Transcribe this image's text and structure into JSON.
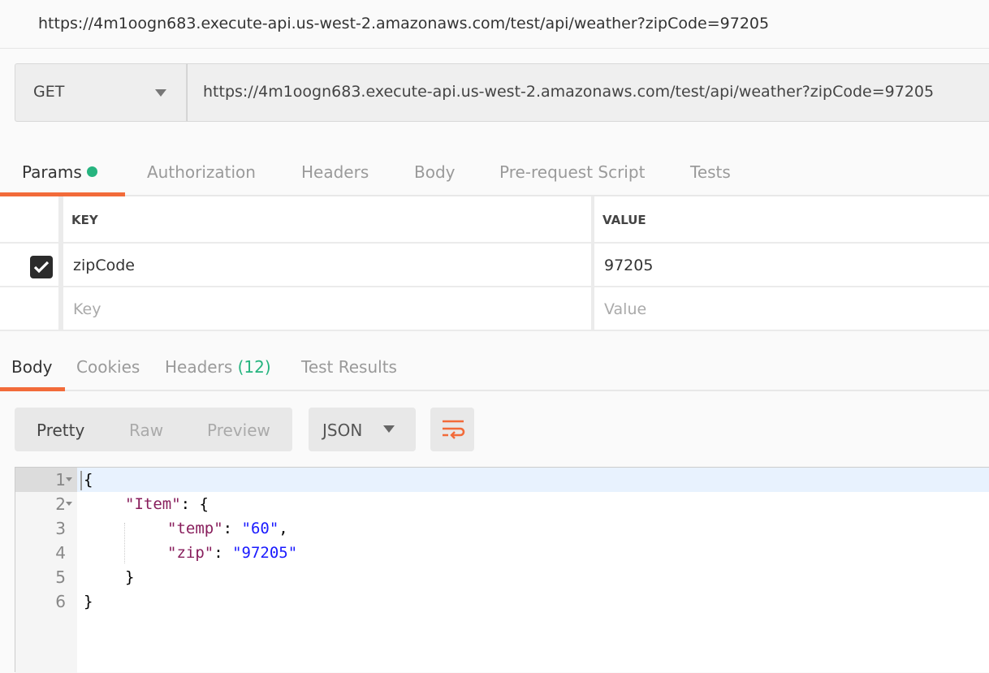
{
  "window": {
    "title": "https://4m1oogn683.execute-api.us-west-2.amazonaws.com/test/api/weather?zipCode=97205"
  },
  "request": {
    "method": "GET",
    "url": "https://4m1oogn683.execute-api.us-west-2.amazonaws.com/test/api/weather?zipCode=97205"
  },
  "request_tabs": [
    "Params",
    "Authorization",
    "Headers",
    "Body",
    "Pre-request Script",
    "Tests"
  ],
  "params": {
    "headers": {
      "key": "KEY",
      "value": "VALUE"
    },
    "rows": [
      {
        "checked": true,
        "key": "zipCode",
        "value": "97205"
      }
    ],
    "placeholder": {
      "key": "Key",
      "value": "Value"
    }
  },
  "response_tabs": {
    "body": "Body",
    "cookies": "Cookies",
    "headers": "Headers",
    "headers_count": "(12)",
    "tests": "Test Results"
  },
  "view_modes": [
    "Pretty",
    "Raw",
    "Preview"
  ],
  "format": "JSON",
  "wrap_icon": "wrap-lines-icon",
  "code_lines": [
    "1",
    "2",
    "3",
    "4",
    "5",
    "6"
  ],
  "code": {
    "l1": "{",
    "item_key": "\"Item\"",
    "item_rest": ": {",
    "temp_key": "\"temp\"",
    "temp_val": "\"60\"",
    "zip_key": "\"zip\"",
    "zip_val": "\"97205\"",
    "l5": "}",
    "l6": "}"
  },
  "colors": {
    "accent": "#f26b3a",
    "dot": "#26b47f",
    "json_key": "#881e5c",
    "json_string": "#1a1aff"
  }
}
